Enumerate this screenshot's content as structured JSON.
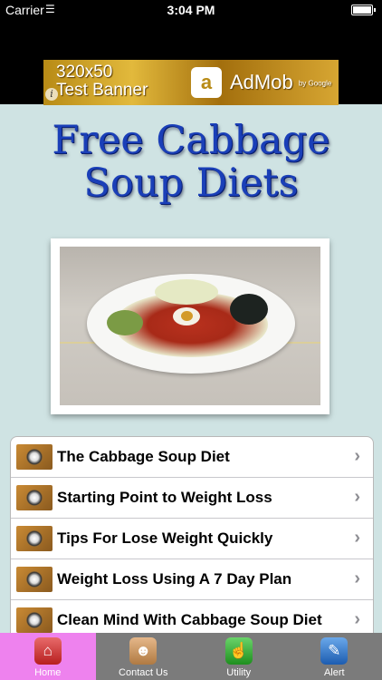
{
  "status_bar": {
    "carrier": "Carrier",
    "time": "3:04 PM"
  },
  "ad": {
    "line1": "320x50",
    "line2": "Test Banner",
    "brand": "AdMob",
    "brand_by": "by Google",
    "info": "i"
  },
  "app_title": "Free Cabbage\nSoup Diets",
  "menu": {
    "items": [
      {
        "label": "The Cabbage Soup Diet"
      },
      {
        "label": "Starting Point to Weight Loss"
      },
      {
        "label": "Tips For Lose Weight Quickly"
      },
      {
        "label": "Weight Loss Using A 7 Day Plan"
      },
      {
        "label": "Clean Mind With Cabbage Soup Diet"
      }
    ]
  },
  "tabs": [
    {
      "label": "Home",
      "icon": "home-icon"
    },
    {
      "label": "Contact Us",
      "icon": "contact-icon"
    },
    {
      "label": "Utility",
      "icon": "utility-icon"
    },
    {
      "label": "Alert",
      "icon": "alert-icon"
    }
  ],
  "colors": {
    "active_tab": "#ee82ee",
    "tab_bar": "#7b7b7b",
    "title": "#1a3fb8",
    "background": "#cfe3e3"
  }
}
